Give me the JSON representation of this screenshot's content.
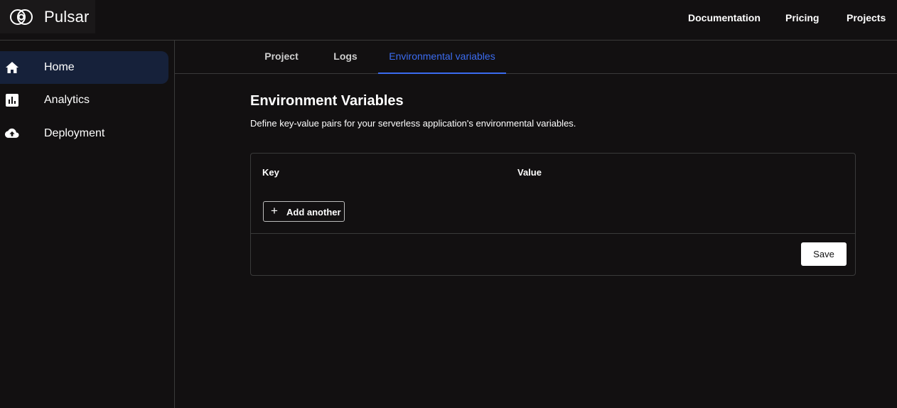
{
  "app": {
    "name": "Pulsar"
  },
  "topnav": {
    "documentation": "Documentation",
    "pricing": "Pricing",
    "projects": "Projects"
  },
  "sidebar": {
    "items": [
      {
        "label": "Home",
        "icon": "home-icon",
        "active": true
      },
      {
        "label": "Analytics",
        "icon": "analytics-icon",
        "active": false
      },
      {
        "label": "Deployment",
        "icon": "cloud-upload-icon",
        "active": false
      }
    ]
  },
  "tabs": [
    {
      "label": "Project",
      "active": false
    },
    {
      "label": "Logs",
      "active": false
    },
    {
      "label": "Environmental variables",
      "active": true
    }
  ],
  "main": {
    "title": "Environment Variables",
    "description": "Define key-value pairs for your serverless application's environmental variables.",
    "table": {
      "key_header": "Key",
      "value_header": "Value"
    },
    "add_button": "Add another",
    "save_button": "Save"
  },
  "colors": {
    "accent": "#3b6cf0",
    "active_bg": "#16213a",
    "background": "#121011"
  }
}
